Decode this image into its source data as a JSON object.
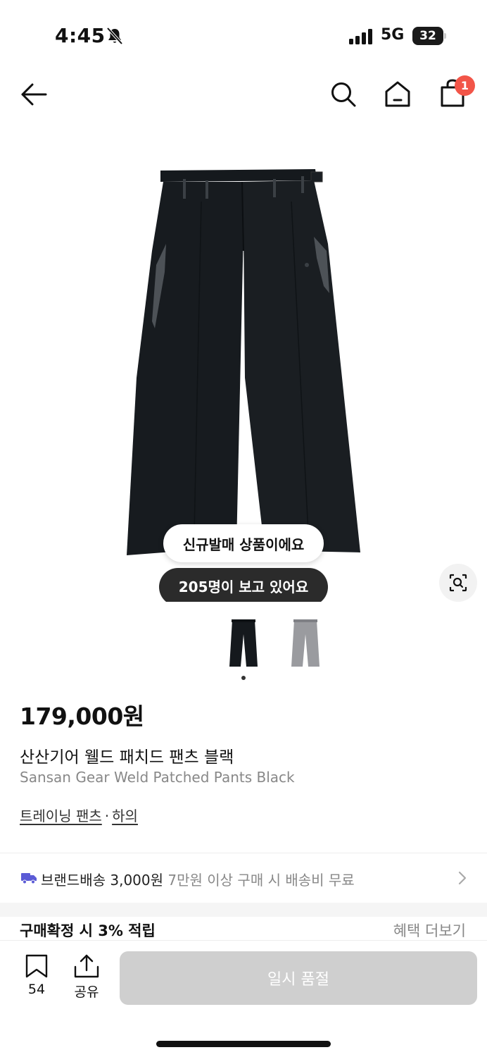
{
  "status_bar": {
    "time": "4:45",
    "network": "5G",
    "battery": "32"
  },
  "header": {
    "icons": [
      "back-arrow-icon",
      "search-icon",
      "home-icon",
      "cart-icon"
    ],
    "cart_badge": "1"
  },
  "product": {
    "badges": {
      "new_release": "신규발매 상품이에요",
      "viewers": "205명이 보고 있어요"
    },
    "thumbnails": [
      "black",
      "gray"
    ],
    "price": "179,000원",
    "name_ko": "산산기어 웰드 패치드 팬츠 블랙",
    "name_en": "Sansan Gear Weld Patched Pants Black",
    "category": {
      "primary": "트레이닝 팬츠",
      "separator": "·",
      "secondary": "하의"
    }
  },
  "shipping": {
    "label": "브랜드배송 3,000원",
    "note": "7만원 이상 구매 시 배송비 무료"
  },
  "reward": {
    "label": "구매확정 시 3% 적립",
    "more": "혜택 더보기"
  },
  "bottom_bar": {
    "like_count": "54",
    "share_label": "공유",
    "cta_label": "일시 품절"
  },
  "colors": {
    "badge_red": "#f25548",
    "shipping_truck": "#5b5bd6",
    "disabled_button": "#cfcfcf"
  }
}
